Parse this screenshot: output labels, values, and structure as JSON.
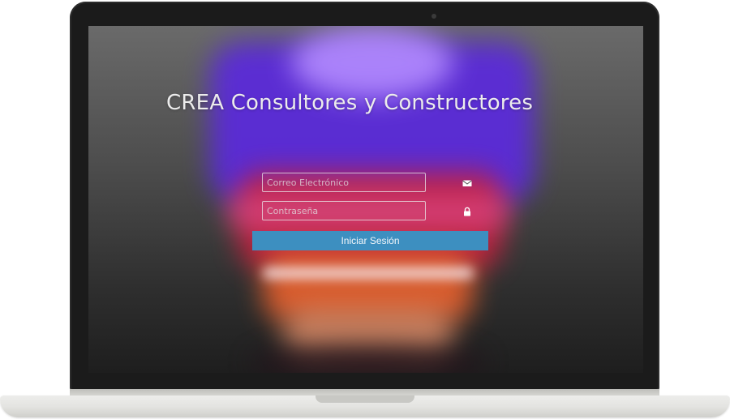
{
  "app": {
    "title": "CREA Consultores y Constructores"
  },
  "login_form": {
    "email": {
      "placeholder": "Correo Electrónico",
      "value": "",
      "icon": "envelope-icon"
    },
    "password": {
      "placeholder": "Contraseña",
      "value": "",
      "icon": "lock-icon"
    },
    "submit_label": "Iniciar Sesión"
  },
  "colors": {
    "button_background": "#3d8fc0",
    "title_text": "#ececec",
    "bezel": "#1b1b1b"
  }
}
